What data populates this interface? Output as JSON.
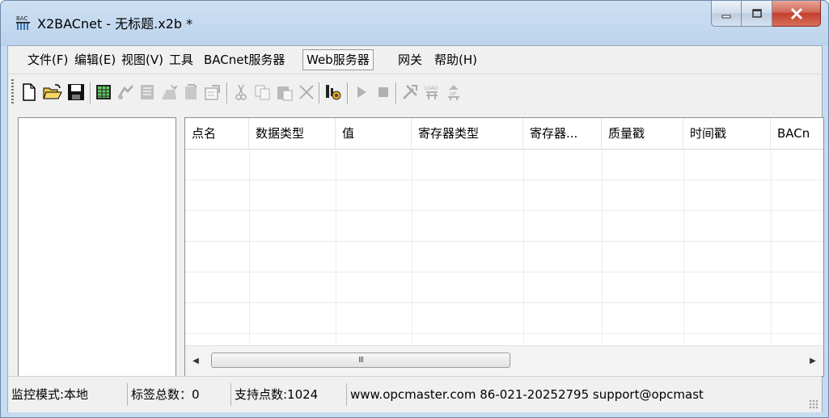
{
  "window": {
    "title": "X2BACnet - 无标题.x2b *",
    "app_icon": "bacnet-app-icon",
    "controls": [
      "minimize-icon",
      "maximize-icon",
      "close-icon"
    ]
  },
  "menu": {
    "items": [
      {
        "label": "文件(F)"
      },
      {
        "label": "编辑(E)"
      },
      {
        "label": "视图(V)"
      },
      {
        "label": "工具"
      },
      {
        "label": "BACnet服务器"
      },
      {
        "label": "Web服务器"
      },
      {
        "label": "网关"
      },
      {
        "label": "帮助(H)"
      }
    ],
    "active": "Web服务器"
  },
  "toolbar": {
    "buttons": [
      {
        "icon": "new-file-icon",
        "enabled": true
      },
      {
        "icon": "open-folder-icon",
        "enabled": true
      },
      {
        "icon": "save-icon",
        "enabled": true
      },
      {
        "icon": "add-device-icon",
        "enabled": true
      },
      {
        "icon": "add-group-icon",
        "enabled": false
      },
      {
        "icon": "add-tag-icon",
        "enabled": false
      },
      {
        "icon": "batch-add-icon",
        "enabled": false
      },
      {
        "icon": "delete-item-icon",
        "enabled": false
      },
      {
        "icon": "properties-icon",
        "enabled": false
      },
      {
        "icon": "cut-icon",
        "enabled": false
      },
      {
        "icon": "copy-icon",
        "enabled": false
      },
      {
        "icon": "paste-icon",
        "enabled": false
      },
      {
        "icon": "delete-icon",
        "enabled": false
      },
      {
        "icon": "monitor-icon",
        "enabled": true
      },
      {
        "icon": "run-icon",
        "enabled": false
      },
      {
        "icon": "stop-icon",
        "enabled": false
      },
      {
        "icon": "tools-icon",
        "enabled": false
      },
      {
        "icon": "load-icon",
        "enabled": false
      },
      {
        "icon": "upload-icon",
        "enabled": false
      }
    ]
  },
  "grid": {
    "columns": [
      "点名",
      "数据类型",
      "值",
      "寄存器类型",
      "寄存器...",
      "质量戳",
      "时间戳",
      "BACn"
    ],
    "rows": [],
    "scroll_thumb_label": "III"
  },
  "status": {
    "mode": "监控模式:本地",
    "tag_count": "标签总数：0",
    "supported": "支持点数:1024",
    "contact": "www.opcmaster.com 86-021-20252795 support@opcmast"
  },
  "colors": {
    "title_bg": "#bcd3ec",
    "close_button": "#c33f2c",
    "client_bg": "#f0f0f0"
  }
}
